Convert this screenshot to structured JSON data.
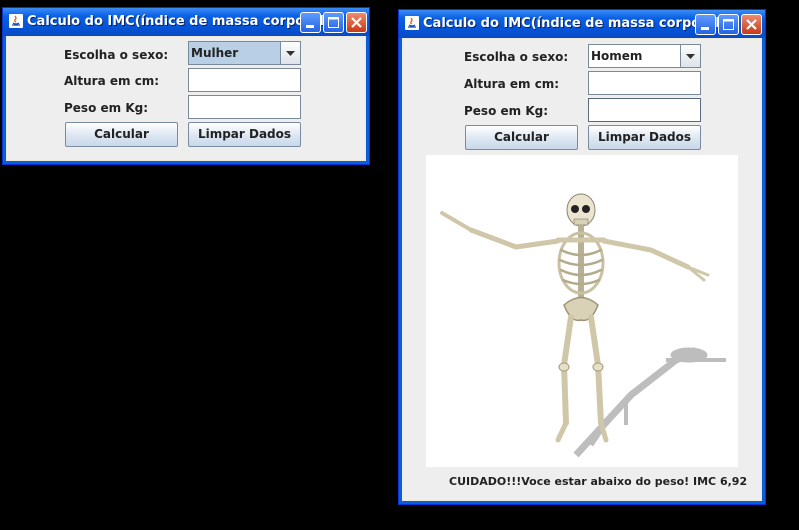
{
  "windows": [
    {
      "title": "Calculo do IMC(índice de massa corporal)",
      "labels": {
        "sexo": "Escolha o sexo:",
        "altura": "Altura em cm:",
        "peso": "Peso em Kg:"
      },
      "sexo_selected": "Mulher",
      "altura_value": "",
      "peso_value": "",
      "buttons": {
        "calcular": "Calcular",
        "limpar": "Limpar Dados"
      }
    },
    {
      "title": "Calculo do IMC(índice de massa corporal)",
      "labels": {
        "sexo": "Escolha o sexo:",
        "altura": "Altura em cm:",
        "peso": "Peso em Kg:"
      },
      "sexo_selected": "Homem",
      "altura_value": "",
      "peso_value": "",
      "buttons": {
        "calcular": "Calcular",
        "limpar": "Limpar Dados"
      },
      "image": "dancing-skeleton",
      "result": "CUIDADO!!!Voce estar abaixo do peso! IMC 6,92"
    }
  ]
}
